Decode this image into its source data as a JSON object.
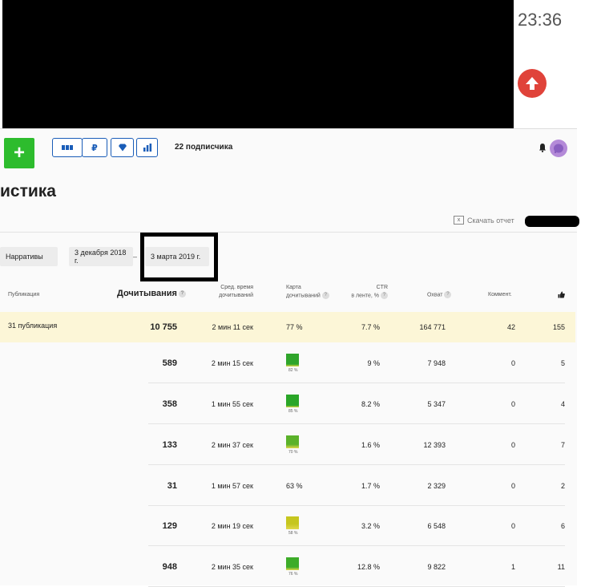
{
  "status": {
    "clock": "23:36"
  },
  "header": {
    "subscribers": "22 подписчика",
    "tools": [
      {
        "name": "grid-icon",
        "glyph": "▮▮▮"
      },
      {
        "name": "ruble-icon",
        "glyph": "₽"
      },
      {
        "name": "diamond-icon",
        "glyph": "◆"
      },
      {
        "name": "bar-chart-icon",
        "glyph": "▟"
      }
    ],
    "plus_label": "+"
  },
  "page": {
    "title": "истика",
    "download": "Скачать отчет",
    "filters": {
      "type": "Нарративы",
      "date_from": "3 декабря 2018 г.",
      "dash": "–",
      "date_to": "3 марта 2019 г."
    }
  },
  "table": {
    "headers": {
      "publication": "Публикация",
      "reads": "Дочитывания",
      "avg_time": [
        "Сред. время",
        "дочитываний"
      ],
      "map": [
        "Карта",
        "дочитываний"
      ],
      "ctr": [
        "CTR",
        "в ленте, %"
      ],
      "reach": "Охват",
      "comments": "Коммент."
    },
    "total": {
      "label": "31 публикация",
      "reads": "10 755",
      "time": "2 мин 11 сек",
      "map": "77 %",
      "ctr": "7.7 %",
      "reach": "164 771",
      "comments": "42",
      "likes": "155"
    },
    "rows": [
      {
        "reads": "589",
        "time": "2 мин 15 сек",
        "map_pct": "82 %",
        "map_value": 82,
        "map_color": "#2fa52b",
        "ctr": "9 %",
        "reach": "7 948",
        "comments": "0",
        "likes": "5"
      },
      {
        "reads": "358",
        "time": "1 мин 55 сек",
        "map_pct": "85 %",
        "map_value": 85,
        "map_color": "#2aa628",
        "ctr": "8.2 %",
        "reach": "5 347",
        "comments": "0",
        "likes": "4"
      },
      {
        "reads": "133",
        "time": "2 мин 37 сек",
        "map_pct": "70 %",
        "map_value": 70,
        "map_color": "#5bb22a",
        "ctr": "1.6 %",
        "reach": "12 393",
        "comments": "0",
        "likes": "7"
      },
      {
        "reads": "31",
        "time": "1 мин 57 сек",
        "map_text": "63 %",
        "ctr": "1.7 %",
        "reach": "2 329",
        "comments": "0",
        "likes": "2"
      },
      {
        "reads": "129",
        "time": "2 мин 19 сек",
        "map_pct": "58 %",
        "map_value": 58,
        "map_color": "#c6c61e",
        "ctr": "3.2 %",
        "reach": "6 548",
        "comments": "0",
        "likes": "6"
      },
      {
        "reads": "948",
        "time": "2 мин 35 сек",
        "map_pct": "76 %",
        "map_value": 76,
        "map_color": "#3dac29",
        "ctr": "12.8 %",
        "reach": "9 822",
        "comments": "1",
        "likes": "11"
      }
    ]
  }
}
